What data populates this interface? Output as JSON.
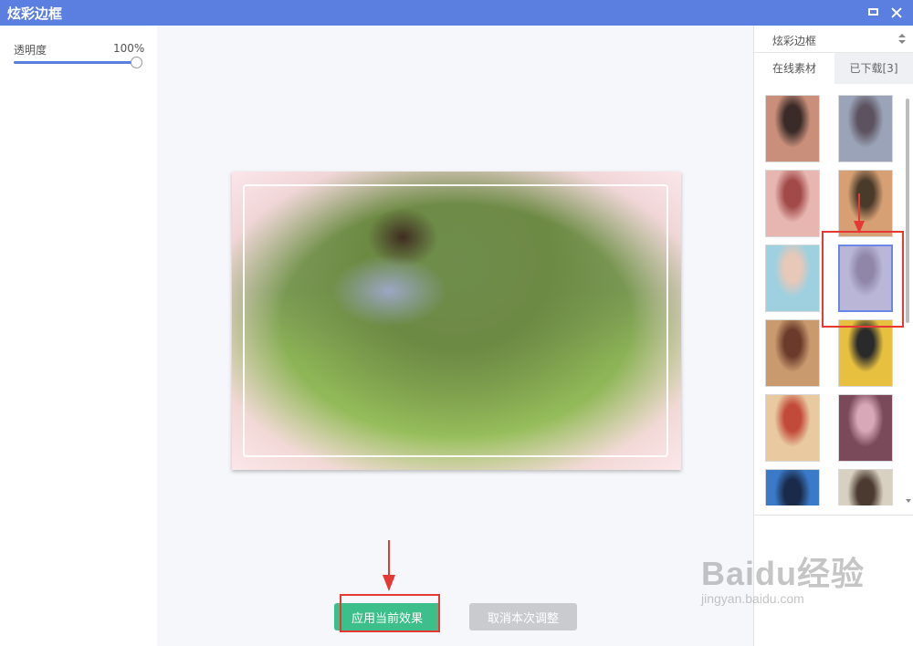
{
  "window": {
    "title": "炫彩边框",
    "icons": [
      "maximize-icon",
      "close-icon"
    ],
    "accent": "#5b7fe0"
  },
  "adjust": {
    "opacity_label": "透明度",
    "opacity_value": "100%",
    "opacity_fraction": 1.0
  },
  "preview": {
    "description_icon": "photo-preview"
  },
  "actions": {
    "apply_label": "应用当前效果",
    "apply_color": "#3cbf8a",
    "cancel_label": "取消本次调整",
    "cancel_color": "#c9cbcf"
  },
  "sidebar": {
    "category": "炫彩边框",
    "tabs": [
      {
        "label": "在线素材",
        "active": true
      },
      {
        "label": "已下载[3]",
        "active": false
      }
    ],
    "thumbnails": [
      {
        "colors": [
          "#c98f7a",
          "#3a2a28"
        ],
        "selected": false
      },
      {
        "colors": [
          "#9aa3b8",
          "#5d5360"
        ],
        "selected": false
      },
      {
        "colors": [
          "#e7b6b0",
          "#a24a4a"
        ],
        "selected": false
      },
      {
        "colors": [
          "#d6a074",
          "#4a3a2a"
        ],
        "selected": false
      },
      {
        "colors": [
          "#9fd0e0",
          "#e8c8b8"
        ],
        "selected": false
      },
      {
        "colors": [
          "#b9b6d8",
          "#8f86a8"
        ],
        "selected": true
      },
      {
        "colors": [
          "#c99a6e",
          "#6a3a2a"
        ],
        "selected": false
      },
      {
        "colors": [
          "#e8c040",
          "#2a2a2a"
        ],
        "selected": false
      },
      {
        "colors": [
          "#e8c9a0",
          "#c24a3a"
        ],
        "selected": false
      },
      {
        "colors": [
          "#7a4a5a",
          "#d8a8b8"
        ],
        "selected": false
      },
      {
        "colors": [
          "#3a7ac8",
          "#1a2a4a"
        ],
        "selected": false
      },
      {
        "colors": [
          "#d8d0c0",
          "#4a3a30"
        ],
        "selected": false
      }
    ]
  },
  "watermark": {
    "main": "Baidu经验",
    "sub": "jingyan.baidu.com"
  }
}
